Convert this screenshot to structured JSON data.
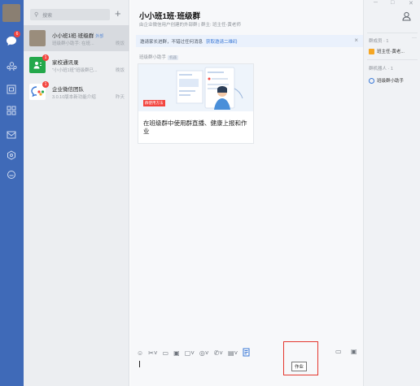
{
  "search": {
    "placeholder": "搜索"
  },
  "conversations": [
    {
      "name": "小小班1班·班级群",
      "tag": "外部",
      "snippet": "班级群小助手: 在班...",
      "time": "晚饭"
    },
    {
      "name": "家校通讯录",
      "snippet": "\"小小班1班\"班级群已...",
      "time": "晚饭",
      "badge": "1"
    },
    {
      "name": "企业微信团队",
      "snippet": "3.0.10版本新功能介绍",
      "time": "昨天",
      "badge": "1"
    }
  ],
  "rail": {
    "badge": "6"
  },
  "chat": {
    "title": "小小班1班·班级群",
    "subtitle": "由企业微信用户创建的外部群 | 群主: 班主任-黄老师",
    "notice_text": "邀请家长进群，不错过任何消息",
    "notice_link": "获取邀请二维码",
    "sender": "班级群小助手",
    "sender_tag": "机器",
    "card_text": "在班级群中使用群直播、健康上报和作业",
    "card_badge": "群使用方法",
    "tooltip": "作业"
  },
  "side": {
    "members_label": "群成员 · 1",
    "member_name": "班主任-黄老...",
    "robots_label": "群机器人 · 1",
    "robot_name": "班级群小助手",
    "more": "···"
  },
  "colors": {
    "rail": "#3f6ab8",
    "highlight": "#e4372e",
    "badge": "#f3453f",
    "link": "#3a78d6"
  }
}
